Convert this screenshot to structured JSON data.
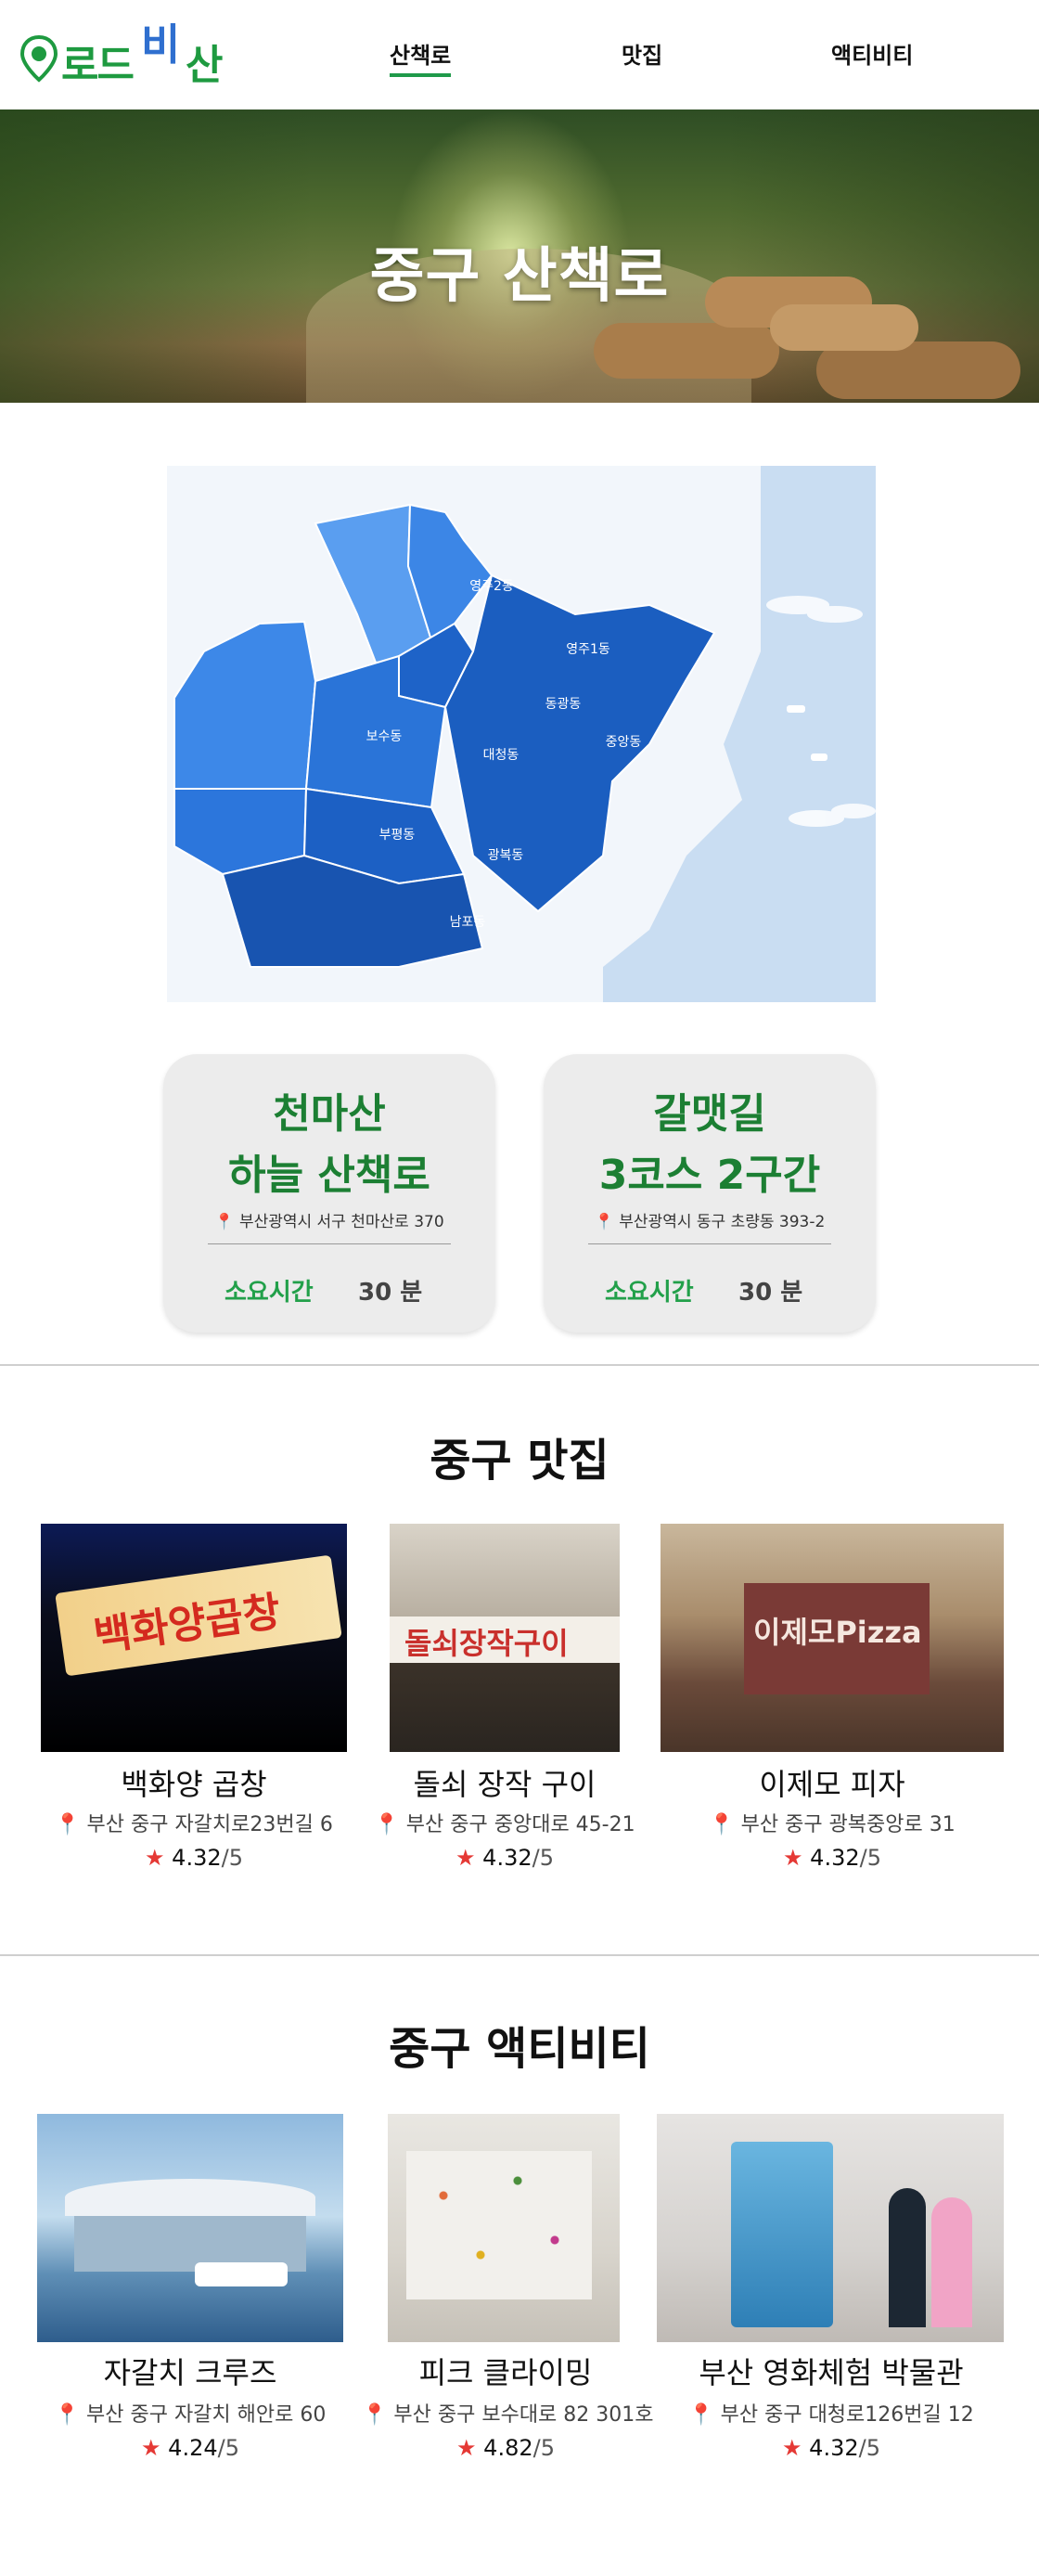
{
  "brand": {
    "logo_text_left": "로드",
    "logo_text_mid": "비",
    "logo_text_right": "산"
  },
  "nav": [
    {
      "label": "산책로"
    },
    {
      "label": "맛집"
    },
    {
      "label": "액티비티"
    }
  ],
  "hero": {
    "title": "중구 산책로"
  },
  "map": {
    "districts": [
      "영주2동",
      "영주1동",
      "보수동",
      "동광동",
      "대청동",
      "중앙동",
      "부평동",
      "광복동",
      "남포동"
    ]
  },
  "trails": [
    {
      "name_line1": "천마산",
      "name_line2": "하늘 산책로",
      "address": "부산광역시 서구 천마산로 370",
      "time_label": "소요시간",
      "time_value": "30 분"
    },
    {
      "name_line1": "갈맷길",
      "name_line2": "3코스 2구간",
      "address": "부산광역시 동구 초량동 393-2",
      "time_label": "소요시간",
      "time_value": "30 분"
    }
  ],
  "restaurants": {
    "title": "중구 맛집",
    "items": [
      {
        "name": "백화양 곱창",
        "address": "부산 중구 자갈치로23번길 6",
        "rating": "4.32",
        "max": "/5",
        "sign": "백화양곱창"
      },
      {
        "name": "돌쇠 장작 구이",
        "address": "부산 중구 중앙대로 45-21",
        "rating": "4.32",
        "max": "/5",
        "sign": "돌쇠장작구이"
      },
      {
        "name": "이제모 피자",
        "address": "부산 중구 광복중앙로 31",
        "rating": "4.32",
        "max": "/5",
        "sign": "이제모Pizza"
      }
    ]
  },
  "activities": {
    "title": "중구 액티비티",
    "items": [
      {
        "name": "자갈치 크루즈",
        "address": "부산 중구 자갈치 해안로 60",
        "rating": "4.24",
        "max": "/5"
      },
      {
        "name": "피크 클라이밍",
        "address": "부산 중구 보수대로 82 301호",
        "rating": "4.82",
        "max": "/5"
      },
      {
        "name": "부산 영화체험 박물관",
        "address": "부산 중구 대청로126번길 12",
        "rating": "4.32",
        "max": "/5"
      }
    ]
  },
  "icons": {
    "location": "location-pin-icon",
    "star": "star-icon"
  },
  "colors": {
    "brand_green": "#1e9a40",
    "accent_green": "#22a04a",
    "map_blue": "#1e63c8",
    "star_red": "#e53935"
  }
}
